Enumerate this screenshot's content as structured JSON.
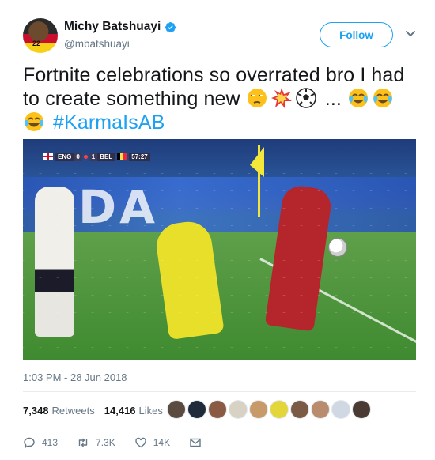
{
  "author": {
    "name": "Michy Batshuayi",
    "handle": "@mbatshuayi",
    "avatar_number": "22",
    "verified": true
  },
  "follow_label": "Follow",
  "tweet": {
    "text_main": "Fortnite celebrations so overrated bro I had to create something new",
    "ellipsis": "...",
    "hashtag": "#KarmaIsAB",
    "emojis": [
      "unamused-face",
      "collision",
      "soccer-ball",
      "face-with-tears-of-joy"
    ]
  },
  "media": {
    "scorebug": {
      "team1": "ENG",
      "score1": "0",
      "score2": "1",
      "team2": "BEL",
      "clock": "57:27"
    }
  },
  "timestamp": "1:03 PM - 28 Jun 2018",
  "stats": {
    "retweets_count": "7,348",
    "retweets_label": "Retweets",
    "likes_count": "14,416",
    "likes_label": "Likes"
  },
  "actions": {
    "replies": "413",
    "retweets": "7.3K",
    "likes": "14K"
  },
  "colors": {
    "accent": "#1da1f2",
    "text": "#14171a",
    "muted": "#657786"
  }
}
